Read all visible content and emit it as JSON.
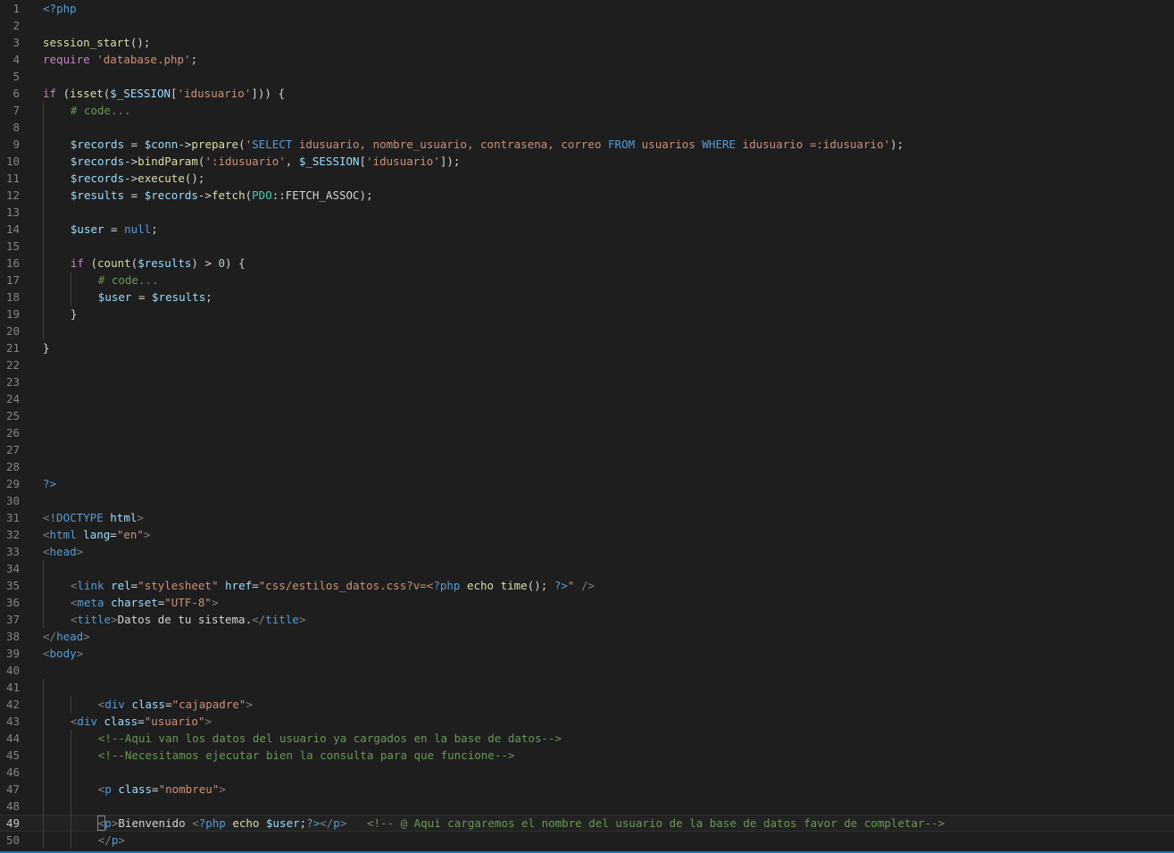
{
  "editor": {
    "language": "php",
    "current_line": 49,
    "accent_color": "#007acc",
    "lines": [
      {
        "n": "1",
        "indent": 0,
        "tokens": [
          [
            "kw",
            "<?php"
          ]
        ]
      },
      {
        "n": "2",
        "indent": 0,
        "tokens": []
      },
      {
        "n": "3",
        "indent": 0,
        "tokens": [
          [
            "fn",
            "session_start"
          ],
          [
            "plain",
            "();"
          ]
        ]
      },
      {
        "n": "4",
        "indent": 0,
        "tokens": [
          [
            "ctrl",
            "require"
          ],
          [
            "plain",
            " "
          ],
          [
            "str",
            "'database.php'"
          ],
          [
            "plain",
            ";"
          ]
        ]
      },
      {
        "n": "5",
        "indent": 0,
        "tokens": []
      },
      {
        "n": "6",
        "indent": 0,
        "tokens": [
          [
            "ctrl",
            "if"
          ],
          [
            "plain",
            " ("
          ],
          [
            "fn",
            "isset"
          ],
          [
            "plain",
            "("
          ],
          [
            "var",
            "$_SESSION"
          ],
          [
            "plain",
            "["
          ],
          [
            "str",
            "'idusuario'"
          ],
          [
            "plain",
            "])) {"
          ]
        ]
      },
      {
        "n": "7",
        "indent": 1,
        "tokens": [
          [
            "cmt",
            "# code..."
          ]
        ]
      },
      {
        "n": "8",
        "indent": 1,
        "tokens": []
      },
      {
        "n": "9",
        "indent": 1,
        "tokens": [
          [
            "var",
            "$records"
          ],
          [
            "plain",
            " = "
          ],
          [
            "var",
            "$conn"
          ],
          [
            "plain",
            "->"
          ],
          [
            "fn",
            "prepare"
          ],
          [
            "plain",
            "("
          ],
          [
            "str",
            "'"
          ],
          [
            "kw",
            "SELECT"
          ],
          [
            "str",
            " idusuario, nombre_usuario, contrasena, correo "
          ],
          [
            "kw",
            "FROM"
          ],
          [
            "str",
            " usuarios "
          ],
          [
            "kw",
            "WHERE"
          ],
          [
            "str",
            " idusuario =:idusuario'"
          ],
          [
            "plain",
            ");"
          ]
        ]
      },
      {
        "n": "10",
        "indent": 1,
        "tokens": [
          [
            "var",
            "$records"
          ],
          [
            "plain",
            "->"
          ],
          [
            "fn",
            "bindParam"
          ],
          [
            "plain",
            "("
          ],
          [
            "str",
            "':idusuario'"
          ],
          [
            "plain",
            ", "
          ],
          [
            "var",
            "$_SESSION"
          ],
          [
            "plain",
            "["
          ],
          [
            "str",
            "'idusuario'"
          ],
          [
            "plain",
            "]);"
          ]
        ]
      },
      {
        "n": "11",
        "indent": 1,
        "tokens": [
          [
            "var",
            "$records"
          ],
          [
            "plain",
            "->"
          ],
          [
            "fn",
            "execute"
          ],
          [
            "plain",
            "();"
          ]
        ]
      },
      {
        "n": "12",
        "indent": 1,
        "tokens": [
          [
            "var",
            "$results"
          ],
          [
            "plain",
            " = "
          ],
          [
            "var",
            "$records"
          ],
          [
            "plain",
            "->"
          ],
          [
            "fn",
            "fetch"
          ],
          [
            "plain",
            "("
          ],
          [
            "cls",
            "PDO"
          ],
          [
            "plain",
            "::FETCH_ASSOC);"
          ]
        ]
      },
      {
        "n": "13",
        "indent": 1,
        "tokens": []
      },
      {
        "n": "14",
        "indent": 1,
        "tokens": [
          [
            "var",
            "$user"
          ],
          [
            "plain",
            " = "
          ],
          [
            "kw",
            "null"
          ],
          [
            "plain",
            ";"
          ]
        ]
      },
      {
        "n": "15",
        "indent": 1,
        "tokens": []
      },
      {
        "n": "16",
        "indent": 1,
        "tokens": [
          [
            "ctrl",
            "if"
          ],
          [
            "plain",
            " ("
          ],
          [
            "fn",
            "count"
          ],
          [
            "plain",
            "("
          ],
          [
            "var",
            "$results"
          ],
          [
            "plain",
            ") > "
          ],
          [
            "num",
            "0"
          ],
          [
            "plain",
            ") {"
          ]
        ]
      },
      {
        "n": "17",
        "indent": 2,
        "tokens": [
          [
            "cmt",
            "# code..."
          ]
        ]
      },
      {
        "n": "18",
        "indent": 2,
        "tokens": [
          [
            "var",
            "$user"
          ],
          [
            "plain",
            " = "
          ],
          [
            "var",
            "$results"
          ],
          [
            "plain",
            ";"
          ]
        ]
      },
      {
        "n": "19",
        "indent": 1,
        "tokens": [
          [
            "plain",
            "}"
          ]
        ]
      },
      {
        "n": "20",
        "indent": 1,
        "tokens": []
      },
      {
        "n": "21",
        "indent": 0,
        "tokens": [
          [
            "plain",
            "}"
          ]
        ]
      },
      {
        "n": "22",
        "indent": 0,
        "tokens": []
      },
      {
        "n": "23",
        "indent": 0,
        "tokens": []
      },
      {
        "n": "24",
        "indent": 0,
        "tokens": []
      },
      {
        "n": "25",
        "indent": 0,
        "tokens": []
      },
      {
        "n": "26",
        "indent": 0,
        "tokens": []
      },
      {
        "n": "27",
        "indent": 0,
        "tokens": []
      },
      {
        "n": "28",
        "indent": 0,
        "tokens": []
      },
      {
        "n": "29",
        "indent": 0,
        "tokens": [
          [
            "kw",
            "?>"
          ]
        ]
      },
      {
        "n": "30",
        "indent": 0,
        "tokens": []
      },
      {
        "n": "31",
        "indent": 0,
        "tokens": [
          [
            "punc",
            "<"
          ],
          [
            "tag",
            "!DOCTYPE"
          ],
          [
            "plain",
            " "
          ],
          [
            "attr",
            "html"
          ],
          [
            "punc",
            ">"
          ]
        ]
      },
      {
        "n": "32",
        "indent": 0,
        "tokens": [
          [
            "punc",
            "<"
          ],
          [
            "tag",
            "html"
          ],
          [
            "plain",
            " "
          ],
          [
            "attr",
            "lang"
          ],
          [
            "plain",
            "="
          ],
          [
            "str",
            "\"en\""
          ],
          [
            "punc",
            ">"
          ]
        ]
      },
      {
        "n": "33",
        "indent": 0,
        "tokens": [
          [
            "punc",
            "<"
          ],
          [
            "tag",
            "head"
          ],
          [
            "punc",
            ">"
          ]
        ]
      },
      {
        "n": "34",
        "indent": 1,
        "tokens": []
      },
      {
        "n": "35",
        "indent": 1,
        "tokens": [
          [
            "punc",
            "<"
          ],
          [
            "tag",
            "link"
          ],
          [
            "plain",
            " "
          ],
          [
            "attr",
            "rel"
          ],
          [
            "plain",
            "="
          ],
          [
            "str",
            "\"stylesheet\""
          ],
          [
            "plain",
            " "
          ],
          [
            "attr",
            "href"
          ],
          [
            "plain",
            "="
          ],
          [
            "str",
            "\"css/estilos_datos.css?v=<"
          ],
          [
            "kw",
            "?php"
          ],
          [
            "plain",
            " "
          ],
          [
            "fn",
            "echo"
          ],
          [
            "plain",
            " "
          ],
          [
            "fn",
            "time"
          ],
          [
            "plain",
            "(); "
          ],
          [
            "kw",
            "?>"
          ],
          [
            "str",
            "\""
          ],
          [
            "plain",
            " "
          ],
          [
            "punc",
            "/>"
          ]
        ]
      },
      {
        "n": "36",
        "indent": 1,
        "tokens": [
          [
            "punc",
            "<"
          ],
          [
            "tag",
            "meta"
          ],
          [
            "plain",
            " "
          ],
          [
            "attr",
            "charset"
          ],
          [
            "plain",
            "="
          ],
          [
            "str",
            "\"UTF-8\""
          ],
          [
            "punc",
            ">"
          ]
        ]
      },
      {
        "n": "37",
        "indent": 1,
        "tokens": [
          [
            "punc",
            "<"
          ],
          [
            "tag",
            "title"
          ],
          [
            "punc",
            ">"
          ],
          [
            "plain",
            "Datos de tu sistema."
          ],
          [
            "punc",
            "</"
          ],
          [
            "tag",
            "title"
          ],
          [
            "punc",
            ">"
          ]
        ]
      },
      {
        "n": "38",
        "indent": 0,
        "tokens": [
          [
            "punc",
            "</"
          ],
          [
            "tag",
            "head"
          ],
          [
            "punc",
            ">"
          ]
        ]
      },
      {
        "n": "39",
        "indent": 0,
        "tokens": [
          [
            "punc",
            "<"
          ],
          [
            "tag",
            "body"
          ],
          [
            "punc",
            ">"
          ]
        ]
      },
      {
        "n": "40",
        "indent": 0,
        "tokens": []
      },
      {
        "n": "41",
        "indent": 1,
        "tokens": []
      },
      {
        "n": "42",
        "indent": 2,
        "tokens": [
          [
            "punc",
            "<"
          ],
          [
            "tag",
            "div"
          ],
          [
            "plain",
            " "
          ],
          [
            "attr",
            "class"
          ],
          [
            "plain",
            "="
          ],
          [
            "str",
            "\"cajapadre\""
          ],
          [
            "punc",
            ">"
          ]
        ]
      },
      {
        "n": "43",
        "indent": 1,
        "tokens": [
          [
            "punc",
            "<"
          ],
          [
            "tag",
            "div"
          ],
          [
            "plain",
            " "
          ],
          [
            "attr",
            "class"
          ],
          [
            "plain",
            "="
          ],
          [
            "str",
            "\"usuario\""
          ],
          [
            "punc",
            ">"
          ]
        ]
      },
      {
        "n": "44",
        "indent": 2,
        "tokens": [
          [
            "cmt",
            "<!--Aqui van los datos del usuario ya cargados en la base de datos-->"
          ]
        ]
      },
      {
        "n": "45",
        "indent": 2,
        "tokens": [
          [
            "cmt",
            "<!--Necesitamos ejecutar bien la consulta para que funcione-->"
          ]
        ]
      },
      {
        "n": "46",
        "indent": 2,
        "tokens": []
      },
      {
        "n": "47",
        "indent": 2,
        "tokens": [
          [
            "punc",
            "<"
          ],
          [
            "tag",
            "p"
          ],
          [
            "plain",
            " "
          ],
          [
            "attr",
            "class"
          ],
          [
            "plain",
            "="
          ],
          [
            "str",
            "\"nombreu\""
          ],
          [
            "punc",
            ">"
          ]
        ]
      },
      {
        "n": "48",
        "indent": 2,
        "tokens": []
      },
      {
        "n": "49",
        "indent": 2,
        "tokens": [
          [
            "punc",
            "<"
          ],
          [
            "tag",
            "p"
          ],
          [
            "punc",
            ">"
          ],
          [
            "plain",
            "Bienvenido "
          ],
          [
            "punc",
            "<"
          ],
          [
            "kw",
            "?php"
          ],
          [
            "plain",
            " "
          ],
          [
            "fn",
            "echo"
          ],
          [
            "plain",
            " "
          ],
          [
            "var",
            "$user"
          ],
          [
            "plain",
            ";"
          ],
          [
            "kw",
            "?>"
          ],
          [
            "punc",
            "</"
          ],
          [
            "tag",
            "p"
          ],
          [
            "punc",
            ">"
          ],
          [
            "plain",
            "   "
          ],
          [
            "cmt",
            "<!-- @ Aqui cargaremos el nombre del usuario de la base de datos favor de completar-->"
          ]
        ]
      },
      {
        "n": "50",
        "indent": 2,
        "tokens": [
          [
            "punc",
            "</"
          ],
          [
            "tag",
            "p"
          ],
          [
            "punc",
            ">"
          ]
        ]
      }
    ]
  }
}
